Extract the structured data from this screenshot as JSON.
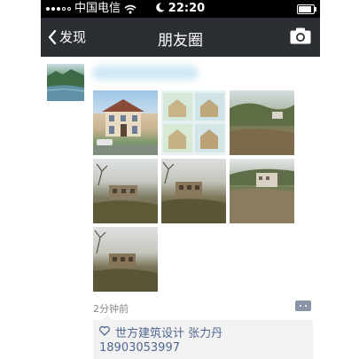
{
  "status_bar": {
    "carrier": "中国电信",
    "time": "22:20"
  },
  "nav": {
    "back_label": "发现",
    "title": "朋友圈"
  },
  "post": {
    "timestamp": "2分钟前",
    "likes": {
      "names": "世方建筑设计  张力丹",
      "phone": "18903053997"
    }
  },
  "icons": [
    "wifi-icon",
    "moon-icon",
    "battery-icon",
    "back-chevron-icon",
    "camera-icon",
    "heart-icon",
    "comment-icon"
  ],
  "colors": {
    "nav_bg": "#2b2e33",
    "status_bg": "#000000",
    "link_blue": "#506690",
    "timestamp_gray": "#888888",
    "likes_bg": "#f2f2f2"
  }
}
